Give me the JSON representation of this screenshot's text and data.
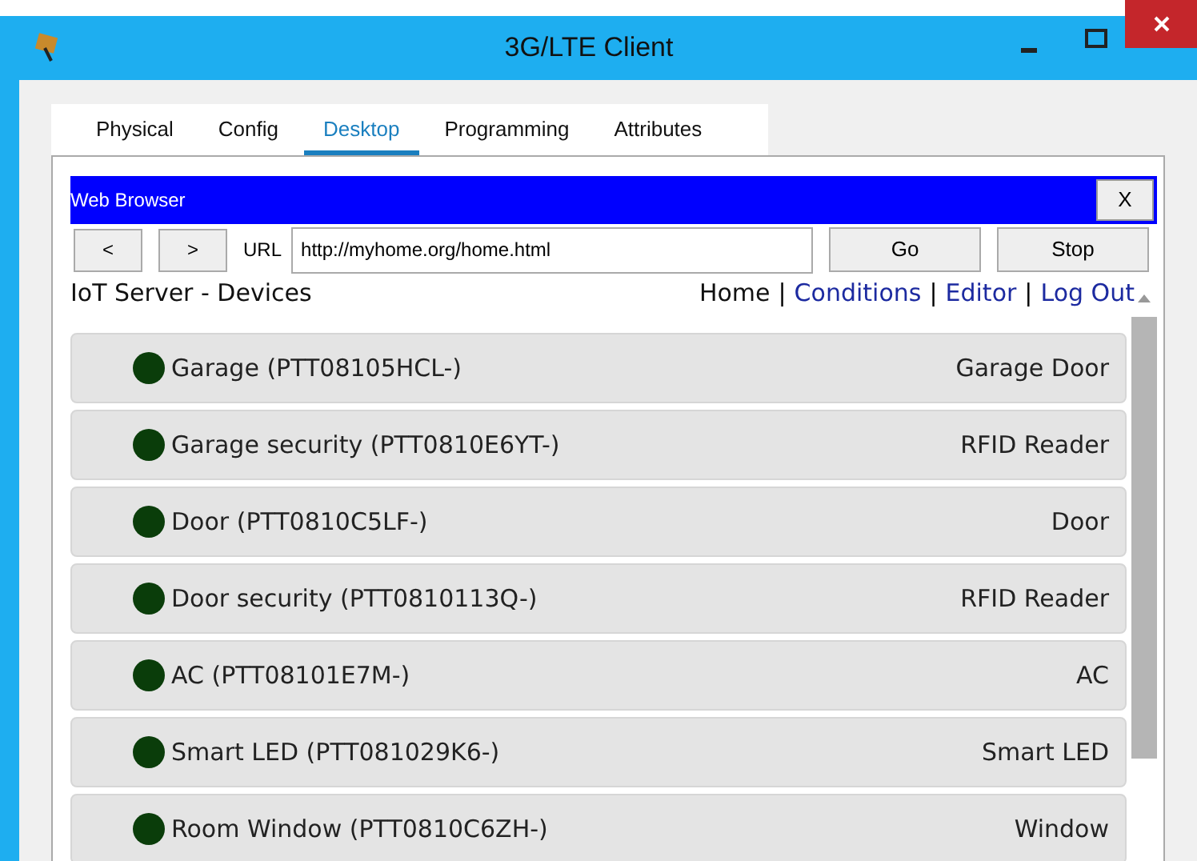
{
  "window": {
    "title": "3G/LTE Client"
  },
  "tabs": [
    {
      "label": "Physical",
      "selected": false
    },
    {
      "label": "Config",
      "selected": false
    },
    {
      "label": "Desktop",
      "selected": true
    },
    {
      "label": "Programming",
      "selected": false
    },
    {
      "label": "Attributes",
      "selected": false
    }
  ],
  "browser": {
    "title": "Web Browser",
    "close": "X",
    "back": "<",
    "forward": ">",
    "url_label": "URL",
    "url": "http://myhome.org/home.html",
    "go": "Go",
    "stop": "Stop"
  },
  "page": {
    "heading": "IoT Server - Devices",
    "nav": [
      {
        "label": "Home",
        "link": false
      },
      {
        "label": "Conditions",
        "link": true
      },
      {
        "label": "Editor",
        "link": true
      },
      {
        "label": "Log Out",
        "link": true
      }
    ],
    "separator": "|"
  },
  "devices": [
    {
      "name": "Garage (PTT08105HCL-)",
      "type": "Garage Door",
      "color": "#0a3d0a"
    },
    {
      "name": "Garage security (PTT0810E6YT-)",
      "type": "RFID Reader",
      "color": "#0a3d0a"
    },
    {
      "name": "Door (PTT0810C5LF-)",
      "type": "Door",
      "color": "#0a3d0a"
    },
    {
      "name": "Door security (PTT0810113Q-)",
      "type": "RFID Reader",
      "color": "#0a3d0a"
    },
    {
      "name": "AC (PTT08101E7M-)",
      "type": "AC",
      "color": "#0a3d0a"
    },
    {
      "name": "Smart LED (PTT081029K6-)",
      "type": "Smart LED",
      "color": "#0a3d0a"
    },
    {
      "name": "Room Window (PTT0810C6ZH-)",
      "type": "Window",
      "color": "#0a3d0a"
    }
  ]
}
